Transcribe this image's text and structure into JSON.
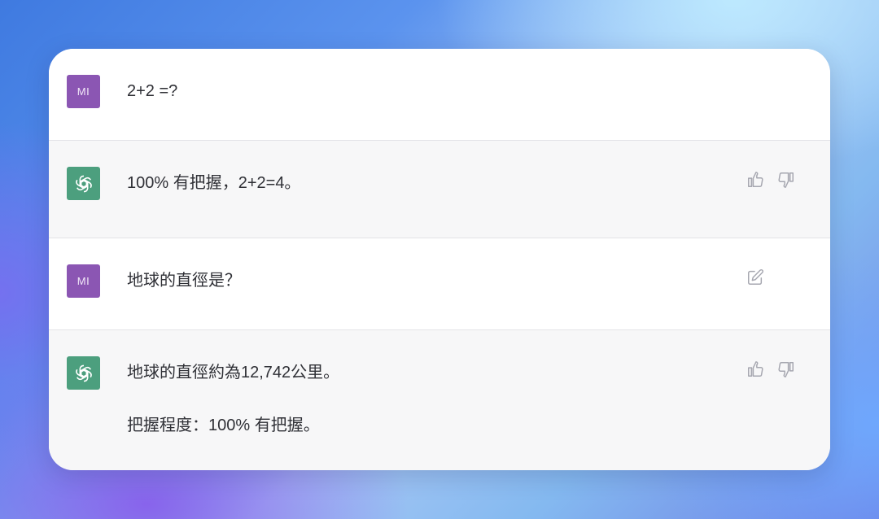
{
  "messages": [
    {
      "role": "user",
      "avatar_initials": "MI",
      "paragraphs": [
        "2+2 =?"
      ]
    },
    {
      "role": "assistant",
      "avatar_icon": "openai-logo-icon",
      "paragraphs": [
        "100% 有把握，2+2=4。"
      ],
      "actions": [
        "thumbs-up-icon",
        "thumbs-down-icon"
      ]
    },
    {
      "role": "user",
      "avatar_initials": "MI",
      "paragraphs": [
        "地球的直徑是？"
      ],
      "actions": [
        "edit-icon"
      ]
    },
    {
      "role": "assistant",
      "avatar_icon": "openai-logo-icon",
      "paragraphs": [
        "地球的直徑約為12,742公里。",
        "把握程度：100% 有把握。"
      ],
      "actions": [
        "thumbs-up-icon",
        "thumbs-down-icon"
      ]
    }
  ],
  "colors": {
    "user_avatar": "#8b56b3",
    "assistant_avatar": "#4c9f7e",
    "assistant_row_bg": "#f7f7f8",
    "icon_gray": "#a6a7b0"
  }
}
